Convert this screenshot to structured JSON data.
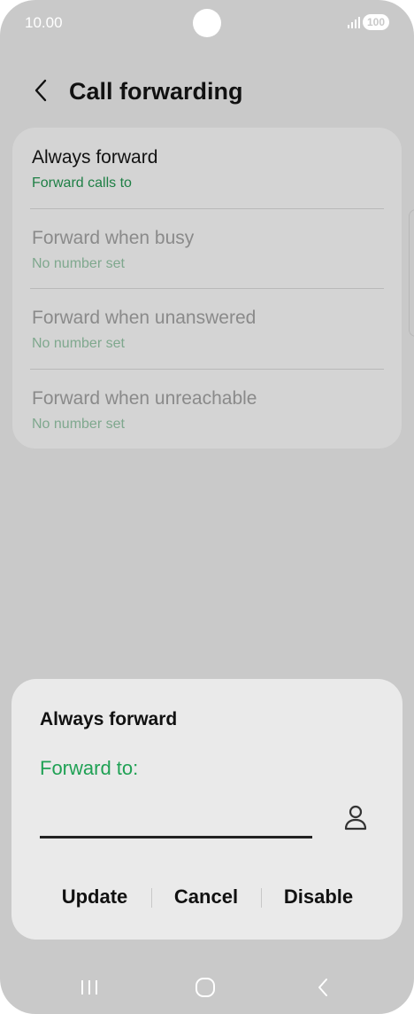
{
  "status_bar": {
    "time": "10.00",
    "battery": "100",
    "icons": [
      "camera-cutout",
      "signal-icon",
      "battery-icon"
    ]
  },
  "header": {
    "back_icon": "chevron-left-icon",
    "title": "Call forwarding"
  },
  "settings": [
    {
      "title": "Always forward",
      "subtitle": "Forward calls to",
      "state": "active"
    },
    {
      "title": "Forward when busy",
      "subtitle": "No number set",
      "state": "dimmed"
    },
    {
      "title": "Forward when unanswered",
      "subtitle": "No number set",
      "state": "dimmed"
    },
    {
      "title": "Forward when unreachable",
      "subtitle": "No number set",
      "state": "dimmed"
    }
  ],
  "dialog": {
    "title": "Always forward",
    "field_label": "Forward to:",
    "field_value": "",
    "contact_icon": "person-icon",
    "buttons": {
      "update": "Update",
      "cancel": "Cancel",
      "disable": "Disable"
    }
  },
  "nav_bar": {
    "icons": [
      "recent-apps-icon",
      "home-icon",
      "back-icon"
    ]
  },
  "colors": {
    "accent_green": "#1fa154",
    "subtitle_green": "#1e7f45",
    "scrim_background": "#c9c9c9",
    "dialog_background": "#eaeaea"
  }
}
